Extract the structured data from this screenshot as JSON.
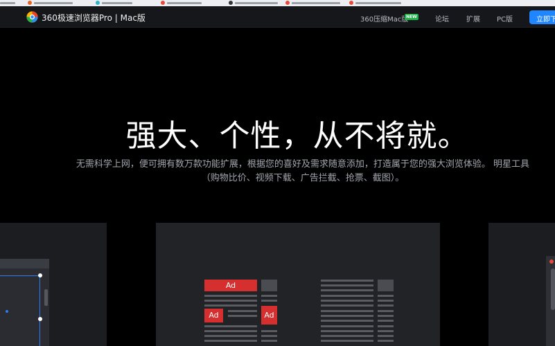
{
  "header": {
    "brand": "360极速浏览器Pro | Mac版",
    "nav": {
      "compress": "360压缩Mac版",
      "compress_badge": "NEW",
      "forum": "论坛",
      "extensions": "扩展",
      "pc": "PC版"
    },
    "download_label": "立即下载"
  },
  "hero": {
    "title": "强大、个性，从不将就。",
    "subtitle": "无需科学上网，便可拥有数万款功能扩展，根据您的喜好及需求随意添加，打造属于您的强大浏览体验。 明星工具（购物比价、视频下载、广告拦截、抢票、截图）。"
  },
  "cards": {
    "adblock": {
      "ad_top": "Ad",
      "ad_left": "Ad",
      "ad_right": "Ad"
    }
  },
  "colors": {
    "accent_blue": "#1f86ff",
    "ad_red": "#d62f2f",
    "new_badge_green": "#1fb14a"
  }
}
